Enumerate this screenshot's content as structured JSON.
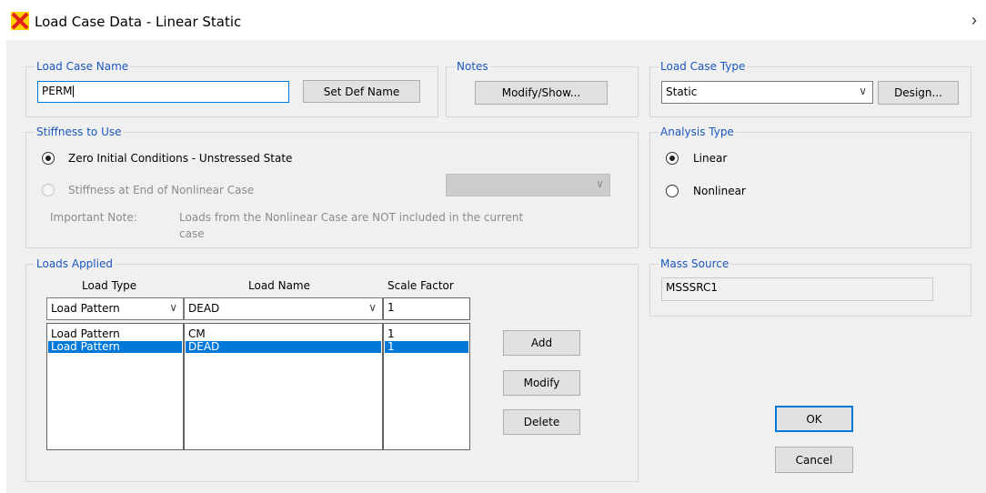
{
  "window": {
    "title": "Load Case Data - Linear Static"
  },
  "load_case_name": {
    "label": "Load Case Name",
    "value": "PERM",
    "set_def_name": "Set Def Name"
  },
  "notes": {
    "label": "Notes",
    "button": "Modify/Show..."
  },
  "load_case_type": {
    "label": "Load Case Type",
    "value": "Static",
    "design_button": "Design..."
  },
  "stiffness": {
    "label": "Stiffness to Use",
    "option_zero": "Zero Initial Conditions - Unstressed State",
    "option_nonlinear": "Stiffness at End of Nonlinear Case",
    "note_label": "Important Note:",
    "note_line1": "Loads from the Nonlinear Case are NOT included in the current",
    "note_line2": "case"
  },
  "analysis_type": {
    "label": "Analysis Type",
    "linear": "Linear",
    "nonlinear": "Nonlinear",
    "selected": "Linear"
  },
  "loads_applied": {
    "label": "Loads Applied",
    "col_load_type": "Load Type",
    "col_load_name": "Load Name",
    "col_scale_factor": "Scale Factor",
    "edit_load_type": "Load Pattern",
    "edit_load_name": "DEAD",
    "edit_scale_factor": "1",
    "rows": [
      {
        "load_type": "Load Pattern",
        "load_name": "CM",
        "scale": "1",
        "selected": false
      },
      {
        "load_type": "Load Pattern",
        "load_name": "DEAD",
        "scale": "1",
        "selected": true
      }
    ],
    "add": "Add",
    "modify": "Modify",
    "delete": "Delete"
  },
  "mass_source": {
    "label": "Mass Source",
    "value": "MSSSRC1"
  },
  "dialog_buttons": {
    "ok": "OK",
    "cancel": "Cancel"
  },
  "colors": {
    "accent": "#0078d7",
    "group_label": "#1a57c0",
    "background": "#f0f0f0"
  }
}
